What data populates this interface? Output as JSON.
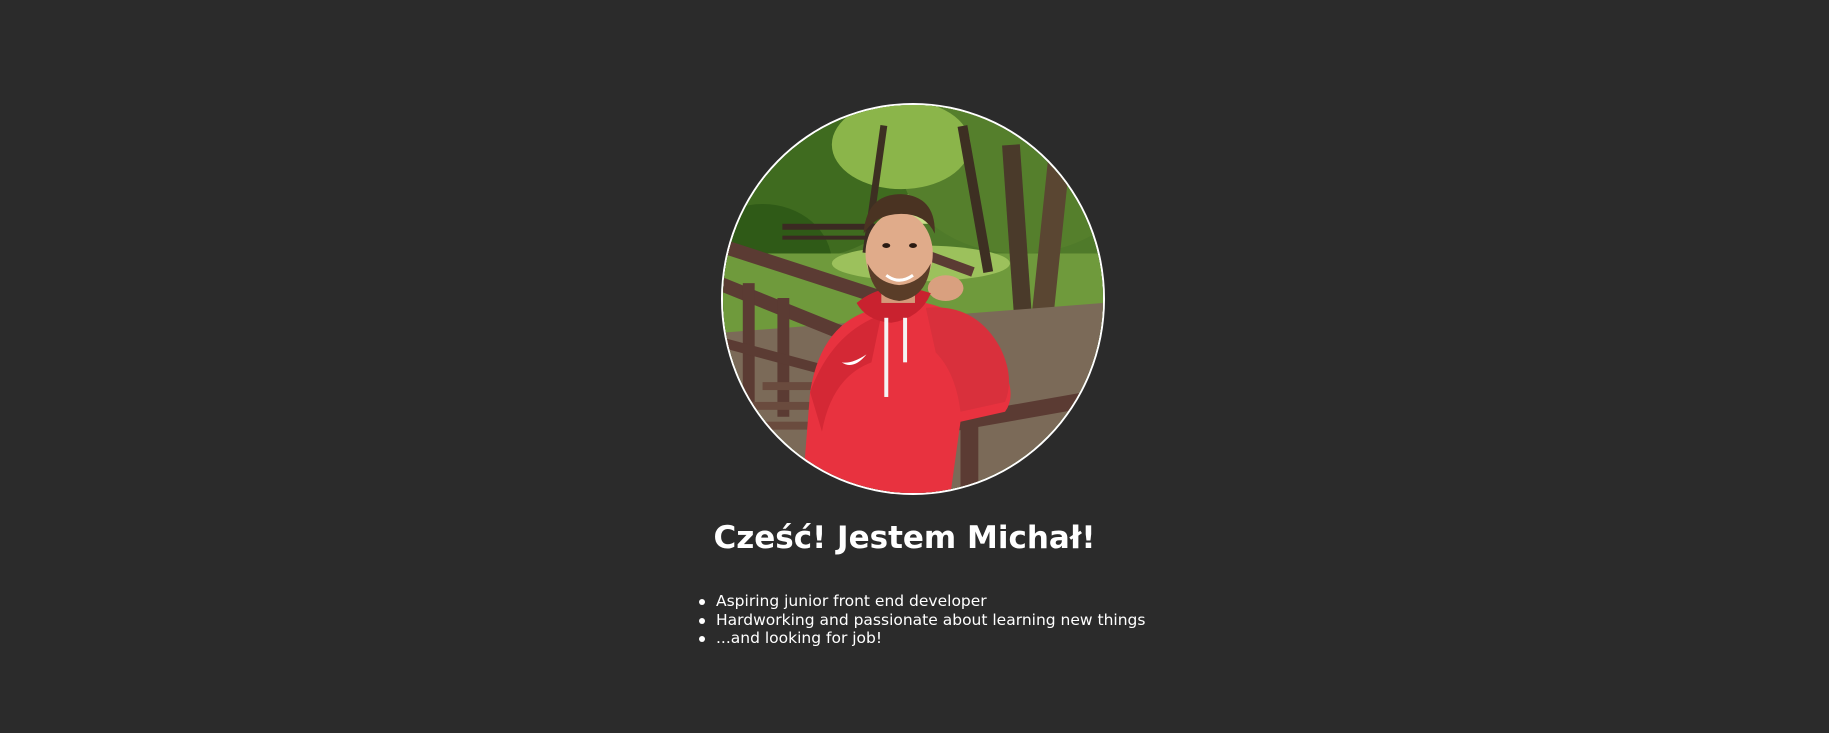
{
  "profile": {
    "photo_icon": "profile-photo",
    "greeting": "Cześć! Jestem Michał!",
    "facts": [
      "Aspiring junior front end developer",
      "Hardworking and passionate about learning new things",
      "...and looking for job!"
    ]
  },
  "colors": {
    "background": "#2b2b2b",
    "text": "#ffffff",
    "photo_border": "#ffffff",
    "hoodie": "#e8323f"
  }
}
